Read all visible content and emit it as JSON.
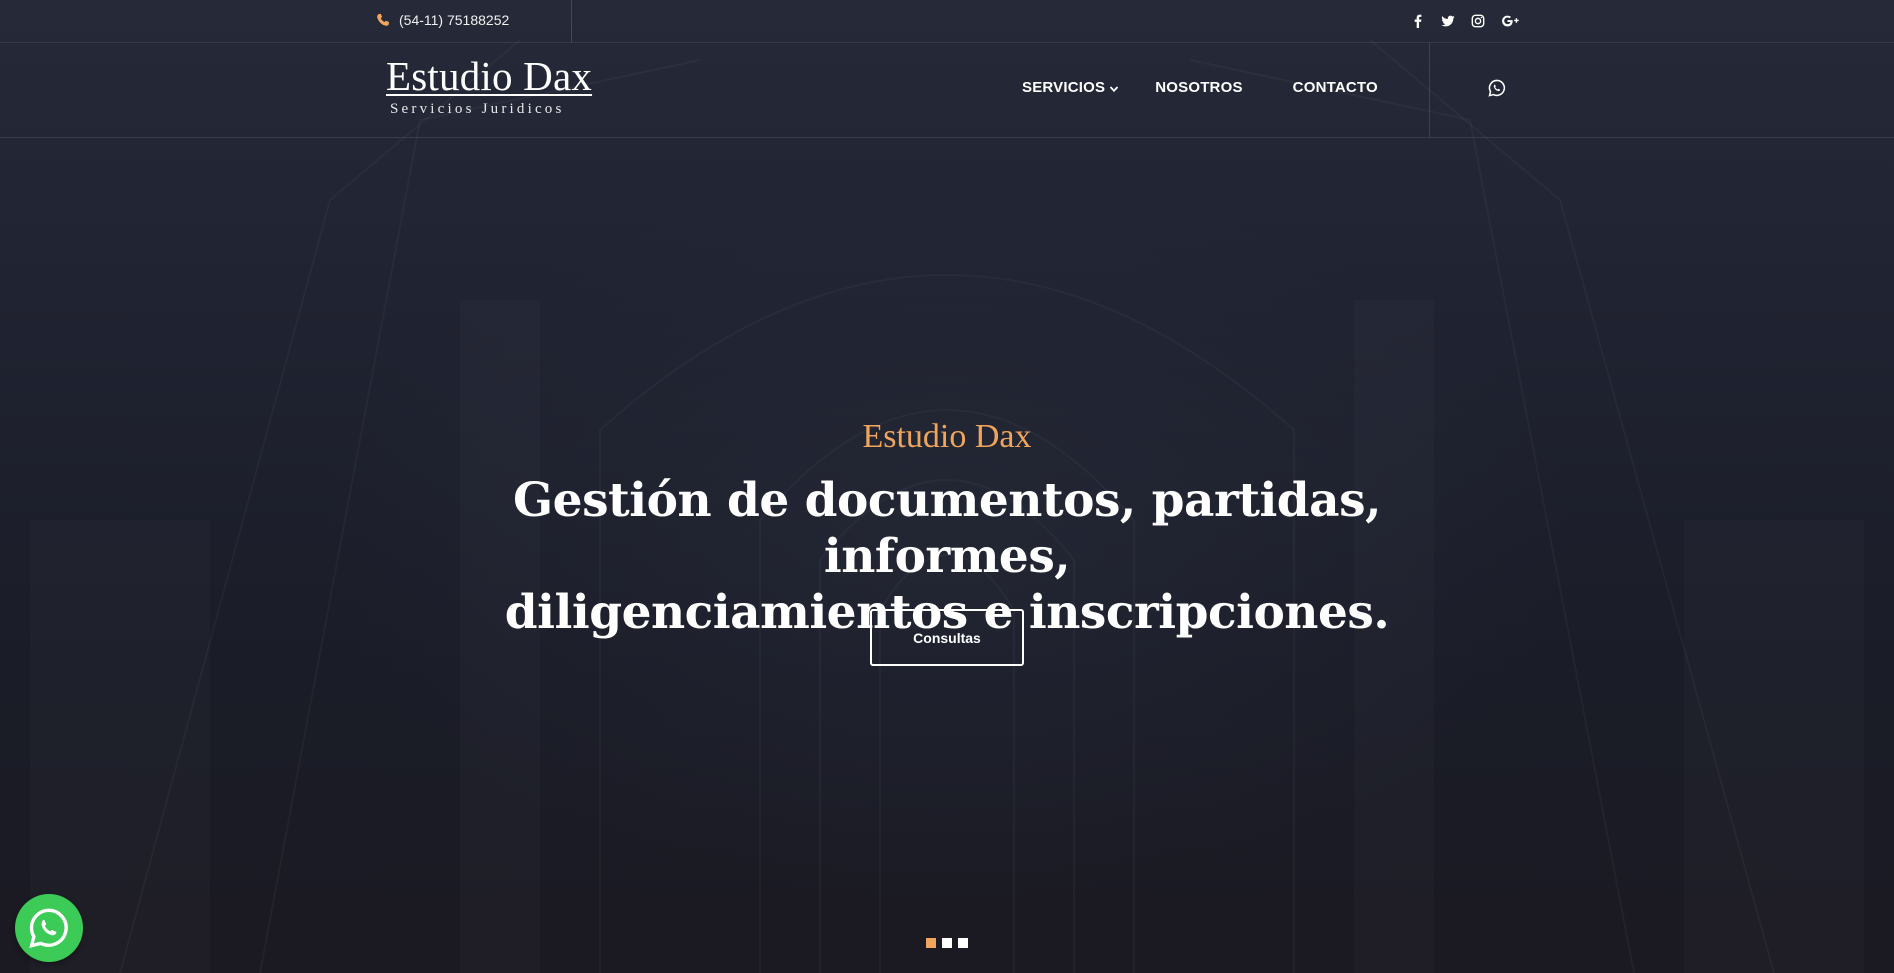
{
  "topbar": {
    "phone": "(54-11) 75188252",
    "phone_icon": "phone-icon",
    "socials": [
      "facebook-icon",
      "twitter-icon",
      "instagram-icon",
      "google-plus-icon"
    ]
  },
  "nav": {
    "logo_title": "Estudio Dax",
    "logo_subtitle": "Servicios Juridicos",
    "menu": [
      {
        "label": "SERVICIOS",
        "has_dropdown": true
      },
      {
        "label": "NOSOTROS",
        "has_dropdown": false
      },
      {
        "label": "CONTACTO",
        "has_dropdown": false
      }
    ],
    "right_icon": "whatsapp-icon"
  },
  "hero": {
    "kicker": "Estudio Dax",
    "title_line1": "Gestión de documentos, partidas, informes,",
    "title_line2": "diligenciamientos e inscripciones.",
    "cta_label": "Consultas",
    "slides_total": 3,
    "active_slide": 1
  },
  "floating": {
    "icon": "whatsapp-icon"
  },
  "colors": {
    "accent": "#f0a45c",
    "background": "#1c1f2a",
    "whatsapp": "#3dcb57",
    "text": "#ffffff"
  }
}
